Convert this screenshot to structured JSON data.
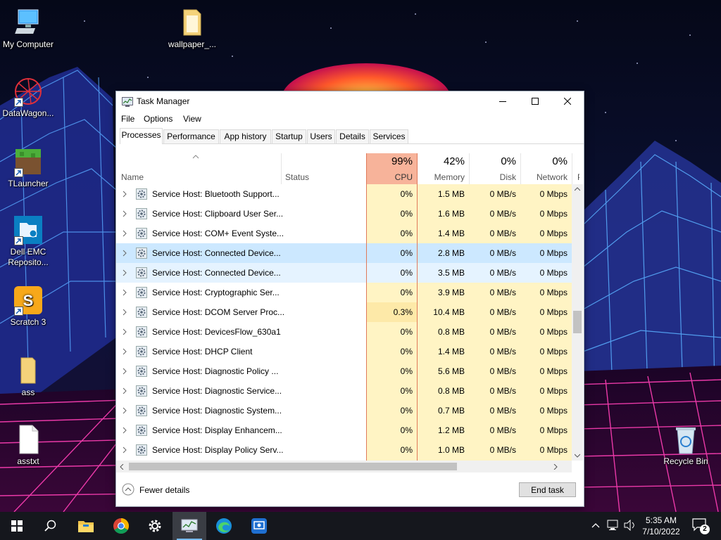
{
  "desktop": {
    "icons": [
      {
        "label": "My Computer"
      },
      {
        "label": "wallpaper_..."
      },
      {
        "label": "DataWagon..."
      },
      {
        "label": "TLauncher"
      },
      {
        "label": "Dell EMC Reposito..."
      },
      {
        "label": "Scratch 3"
      },
      {
        "label": "ass"
      },
      {
        "label": "asstxt"
      },
      {
        "label": "Recycle Bin"
      }
    ]
  },
  "window": {
    "title": "Task Manager",
    "menu": [
      "File",
      "Options",
      "View"
    ],
    "tabs": [
      "Processes",
      "Performance",
      "App history",
      "Startup",
      "Users",
      "Details",
      "Services"
    ],
    "active_tab": "Processes",
    "columns": {
      "name": "Name",
      "status": "Status",
      "cpu": {
        "pct": "99%",
        "label": "CPU"
      },
      "memory": {
        "pct": "42%",
        "label": "Memory"
      },
      "disk": {
        "pct": "0%",
        "label": "Disk"
      },
      "network": {
        "pct": "0%",
        "label": "Network"
      },
      "power": "P"
    },
    "rows": [
      {
        "name": "Service Host: Bluetooth Support...",
        "cpu": "0%",
        "memory": "1.5 MB",
        "disk": "0 MB/s",
        "network": "0 Mbps"
      },
      {
        "name": "Service Host: Clipboard User Ser...",
        "cpu": "0%",
        "memory": "1.6 MB",
        "disk": "0 MB/s",
        "network": "0 Mbps"
      },
      {
        "name": "Service Host: COM+ Event Syste...",
        "cpu": "0%",
        "memory": "1.4 MB",
        "disk": "0 MB/s",
        "network": "0 Mbps"
      },
      {
        "name": "Service Host: Connected Device...",
        "cpu": "0%",
        "memory": "2.8 MB",
        "disk": "0 MB/s",
        "network": "0 Mbps"
      },
      {
        "name": "Service Host: Connected Device...",
        "cpu": "0%",
        "memory": "3.5 MB",
        "disk": "0 MB/s",
        "network": "0 Mbps"
      },
      {
        "name": "Service Host: Cryptographic Ser...",
        "cpu": "0%",
        "memory": "3.9 MB",
        "disk": "0 MB/s",
        "network": "0 Mbps"
      },
      {
        "name": "Service Host: DCOM Server Proc...",
        "cpu": "0.3%",
        "memory": "10.4 MB",
        "disk": "0 MB/s",
        "network": "0 Mbps"
      },
      {
        "name": "Service Host: DevicesFlow_630a1",
        "cpu": "0%",
        "memory": "0.8 MB",
        "disk": "0 MB/s",
        "network": "0 Mbps"
      },
      {
        "name": "Service Host: DHCP Client",
        "cpu": "0%",
        "memory": "1.4 MB",
        "disk": "0 MB/s",
        "network": "0 Mbps"
      },
      {
        "name": "Service Host: Diagnostic Policy ...",
        "cpu": "0%",
        "memory": "5.6 MB",
        "disk": "0 MB/s",
        "network": "0 Mbps"
      },
      {
        "name": "Service Host: Diagnostic Service...",
        "cpu": "0%",
        "memory": "0.8 MB",
        "disk": "0 MB/s",
        "network": "0 Mbps"
      },
      {
        "name": "Service Host: Diagnostic System...",
        "cpu": "0%",
        "memory": "0.7 MB",
        "disk": "0 MB/s",
        "network": "0 Mbps"
      },
      {
        "name": "Service Host: Display Enhancem...",
        "cpu": "0%",
        "memory": "1.2 MB",
        "disk": "0 MB/s",
        "network": "0 Mbps"
      },
      {
        "name": "Service Host: Display Policy Serv...",
        "cpu": "0%",
        "memory": "1.0 MB",
        "disk": "0 MB/s",
        "network": "0 Mbps"
      }
    ],
    "selected_row": 3,
    "hover_row": 4,
    "footer": {
      "fewer_details": "Fewer details",
      "end_task": "End task"
    }
  },
  "taskbar": {
    "time": "5:35 AM",
    "date": "7/10/2022",
    "notification_count": "2",
    "pinned": [
      "start-icon",
      "search-icon",
      "file-explorer-icon",
      "chrome-icon",
      "settings-icon",
      "task-manager-icon",
      "edge-icon",
      "remote-desktop-icon"
    ]
  },
  "colors": {
    "cpu_header_bg": "#f7b39a",
    "cpu_col_bg": "#fff4c4",
    "cpu_hot_bg": "#fde9a8",
    "col_bg": "#fff4c4",
    "selected_row": "#cce8ff",
    "hover_row": "#e5f3ff",
    "taskbar": "#15171d"
  }
}
